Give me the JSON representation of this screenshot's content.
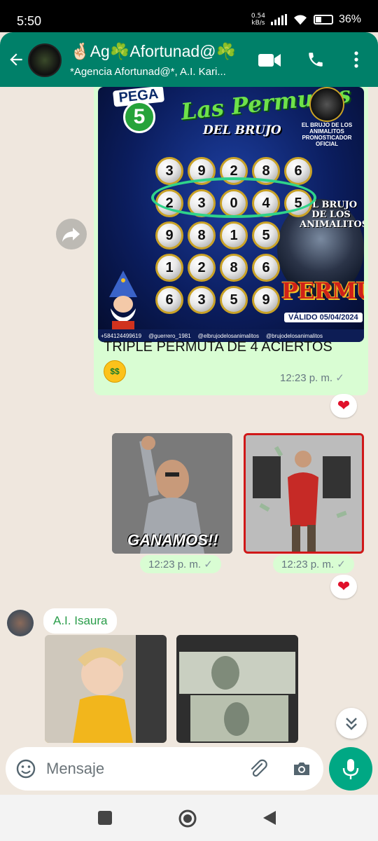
{
  "status_bar": {
    "time": "5:50",
    "net_speed_value": "0.54",
    "net_speed_unit": "kB/s",
    "battery": "36%"
  },
  "header": {
    "title": "🤞🏻Ag☘️Afortunad@☘️",
    "subtitle": "*Agencia Afortunad@*, A.I. Kari...",
    "accent_color": "#008069"
  },
  "messages": {
    "promo": {
      "brand": "PEGA",
      "brand_number": "5",
      "headline_line1": "Las Permutas",
      "headline_line2": "DEL BRUJO",
      "logo_text1": "EL BRUJO DE LOS ANIMALITOS",
      "logo_text2": "PRONOSTICADOR OFICIAL",
      "ball_rows": [
        [
          "3",
          "9",
          "2",
          "8",
          "6"
        ],
        [
          "2",
          "3",
          "0",
          "4",
          "5"
        ],
        [
          "9",
          "8",
          "1",
          "5"
        ],
        [
          "1",
          "2",
          "8",
          "6"
        ],
        [
          "6",
          "3",
          "5",
          "9"
        ]
      ],
      "side_title": "EL BRUJO DE LOS ANIMALITOS",
      "permuta_word": "PERMUTA",
      "valid_text": "VÁLIDO 05/04/2024",
      "footer": [
        "+584124499619",
        "@guerrero_1981",
        "@elbrujodelosanimalitos",
        "@brujodelosanimalitos"
      ],
      "caption": "TRIPLE PERMUTA DE 4 ACIERTOS",
      "emoji_name": "money-mouth-face-emoji",
      "time": "12:23 p. m.",
      "reaction": "❤"
    },
    "gif1": {
      "overlay_text": "GANAMOS!!",
      "time": "12:23 p. m."
    },
    "gif2": {
      "time": "12:23 p. m.",
      "reaction": "❤"
    },
    "incoming": {
      "sender": "A.I. Isaura"
    }
  },
  "composer": {
    "placeholder": "Mensaje"
  },
  "icons": [
    "back-arrow-icon",
    "video-call-icon",
    "voice-call-icon",
    "more-vert-icon",
    "forward-icon",
    "emoji-icon",
    "attach-icon",
    "camera-icon",
    "mic-icon",
    "chevrons-down-icon",
    "nav-recents-icon",
    "nav-home-icon",
    "nav-back-icon"
  ]
}
